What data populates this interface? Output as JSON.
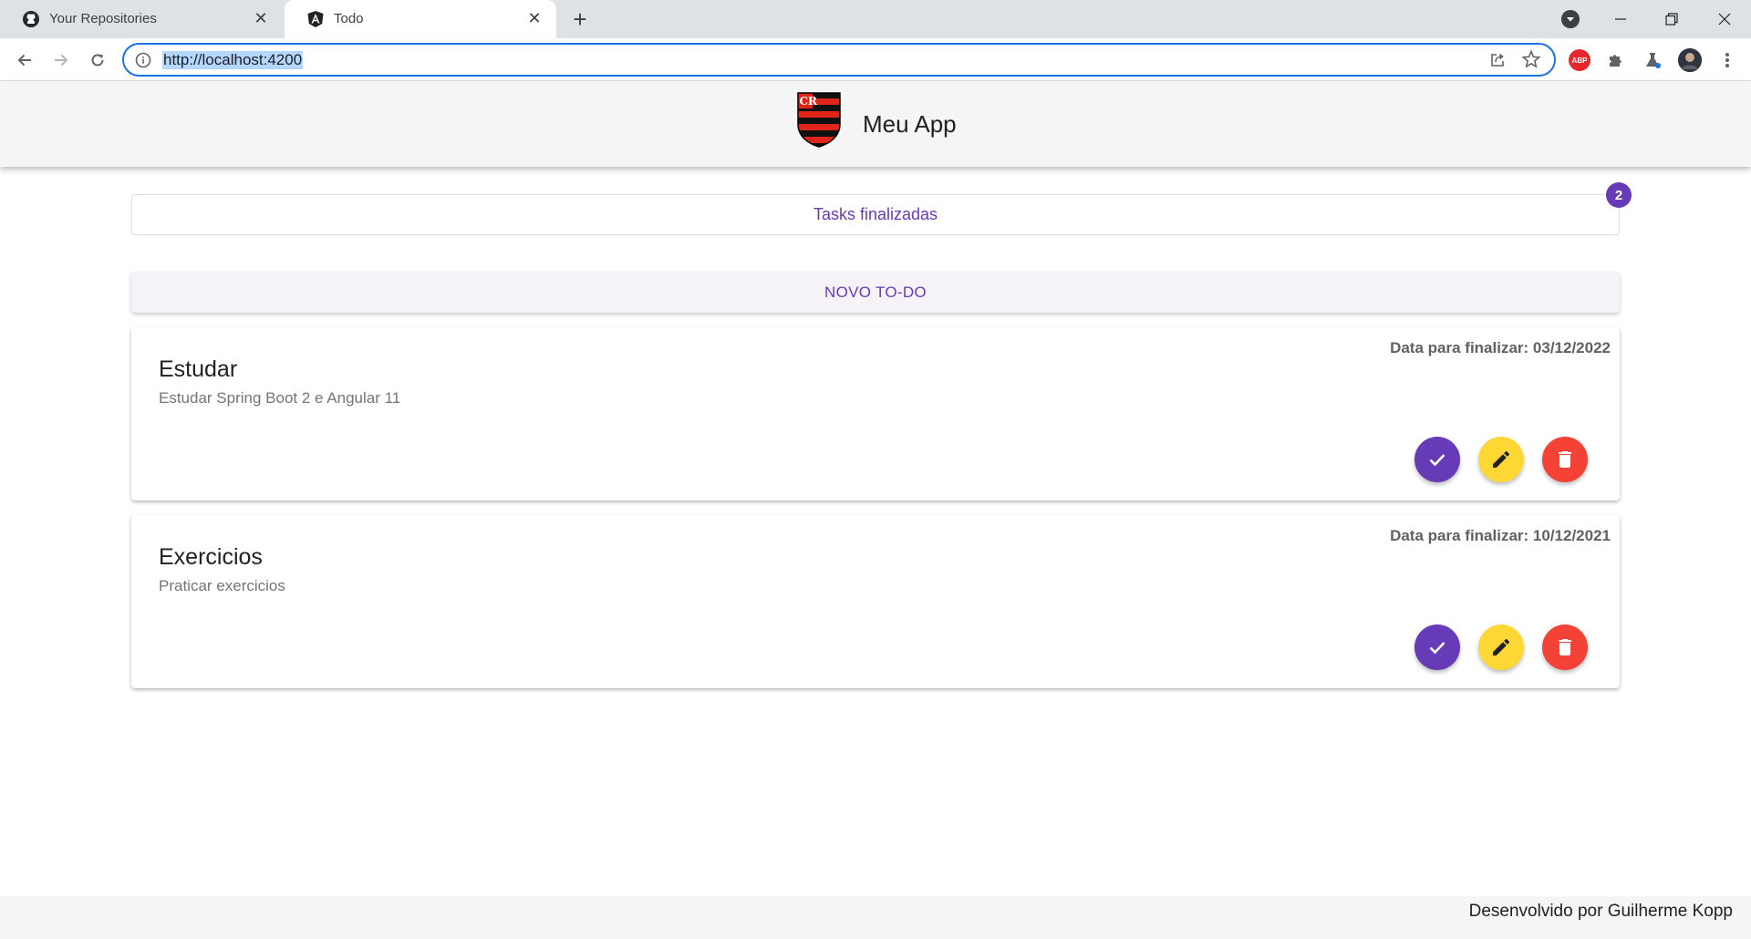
{
  "browser": {
    "tabs": [
      {
        "title": "Your Repositories",
        "favicon": "github-icon"
      },
      {
        "title": "Todo",
        "favicon": "angular-icon"
      }
    ],
    "url": "http://localhost:4200"
  },
  "app": {
    "title": "Meu App",
    "logo": "flamengo-crest",
    "finished_tasks_label": "Tasks finalizadas",
    "finished_count": "2",
    "new_todo_label": "NOVO TO-DO"
  },
  "todos": [
    {
      "title": "Estudar",
      "description": "Estudar Spring Boot 2 e Angular 11",
      "date_label": "Data para finalizar: 03/12/2022"
    },
    {
      "title": "Exercicios",
      "description": "Praticar exercicios",
      "date_label": "Data para finalizar: 10/12/2021"
    }
  ],
  "footer": {
    "text": "Desenvolvido por Guilherme Kopp"
  },
  "colors": {
    "primary": "#673ab7",
    "accent": "#fdd835",
    "warn": "#f44336"
  }
}
